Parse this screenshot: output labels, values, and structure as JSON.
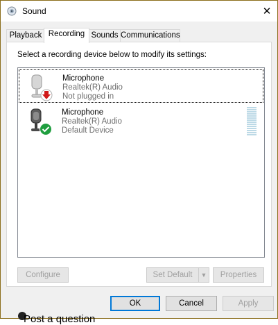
{
  "window": {
    "title": "Sound",
    "close_glyph": "✕"
  },
  "tabs": [
    {
      "label": "Playback"
    },
    {
      "label": "Recording"
    },
    {
      "label": "Sounds"
    },
    {
      "label": "Communications"
    }
  ],
  "panel": {
    "instruction": "Select a recording device below to modify its settings:",
    "devices": [
      {
        "name": "Microphone",
        "driver": "Realtek(R) Audio",
        "status": "Not plugged in",
        "status_icon": "red-down-arrow-icon"
      },
      {
        "name": "Microphone",
        "driver": "Realtek(R) Audio",
        "status": "Default Device",
        "status_icon": "green-check-icon"
      }
    ]
  },
  "buttons": {
    "configure": "Configure",
    "set_default": "Set Default",
    "properties": "Properties",
    "ok": "OK",
    "cancel": "Cancel",
    "apply": "Apply"
  },
  "background_text": "Post a question"
}
